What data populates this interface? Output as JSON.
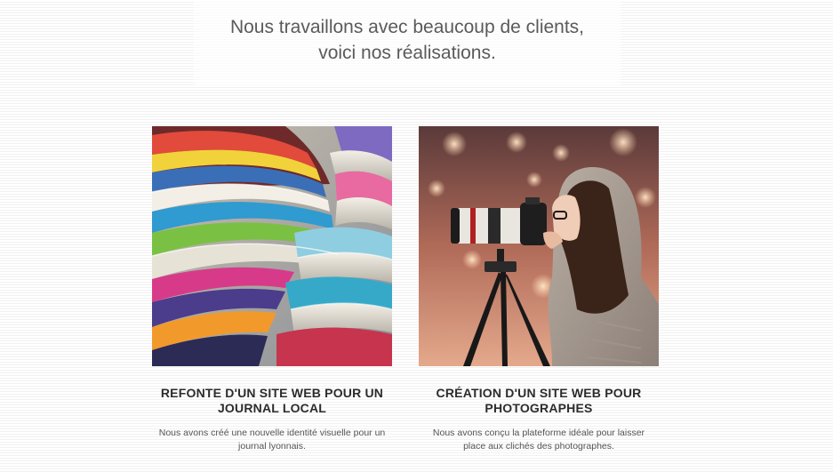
{
  "intro": {
    "line1": "Nous travaillons avec beaucoup de clients,",
    "line2": "voici nos réalisations."
  },
  "projects": [
    {
      "title_line1": "REFONTE D'UN SITE WEB POUR UN",
      "title_line2": "JOURNAL LOCAL",
      "desc_line1": "Nous avons créé une nouvelle identité visuelle pour un",
      "desc_line2": "journal lyonnais.",
      "image": "magazines-photo"
    },
    {
      "title_line1": "CRÉATION D'UN SITE WEB POUR",
      "title_line2": "PHOTOGRAPHES",
      "desc_line1": "Nous avons conçu la plateforme idéale pour laisser",
      "desc_line2": "place aux clichés des photographes.",
      "image": "photographer-photo"
    }
  ],
  "colors": {
    "text_dark": "#2c2c2c",
    "text_mid": "#5a5a5a",
    "text_light": "#555555",
    "stripe": "#f1f1f1"
  }
}
